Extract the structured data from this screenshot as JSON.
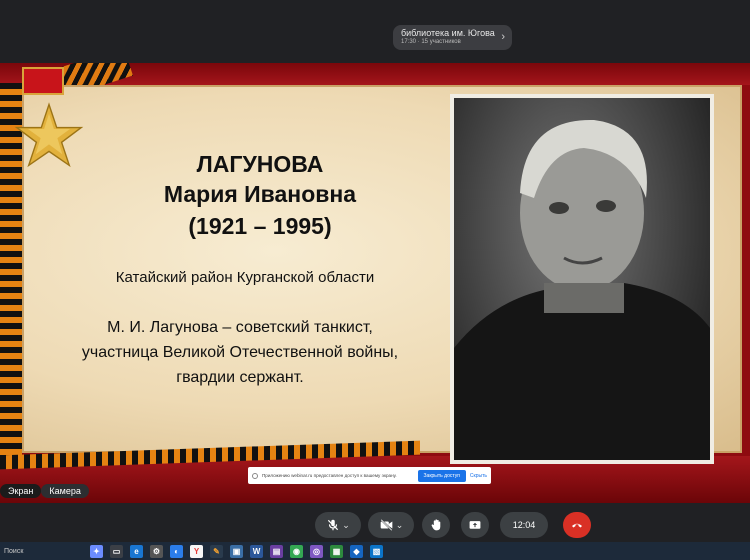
{
  "meeting": {
    "title": "библиотека им. Югова",
    "subtitle": "17:30 · 15 участников"
  },
  "slide": {
    "surname": "ЛАГУНОВА",
    "given_name": "Мария Ивановна",
    "years": "(1921 – 1995)",
    "region": "Катайский район Курганской области",
    "bio_lines": [
      "М. И. Лагунова – советский танкист,",
      "участница Великой Отечественной войны,",
      "гвардии сержант."
    ]
  },
  "notice": {
    "text": "Приложению webinar.ru предоставлен доступ к вашему экрану.",
    "close_button": "Закрыть доступ",
    "hide_link": "Скрыть"
  },
  "source_switch": {
    "screen": "Экран",
    "camera": "Камера"
  },
  "toolbar": {
    "clock": "12:04"
  },
  "taskbar": {
    "search": "Поиск",
    "icons": [
      "copilot-icon",
      "task-view-icon",
      "edge-icon",
      "settings-icon",
      "app-icon",
      "yandex-icon",
      "pencil-icon",
      "photo-icon",
      "word-icon",
      "notepad-icon",
      "chrome-icon",
      "disk-icon",
      "store-icon",
      "game-icon",
      "maps-icon"
    ]
  },
  "colors": {
    "frame_red": "#8e0b10",
    "ribbon_orange": "#e58312",
    "hangup_red": "#d93025",
    "accent_blue": "#1a73e8"
  }
}
